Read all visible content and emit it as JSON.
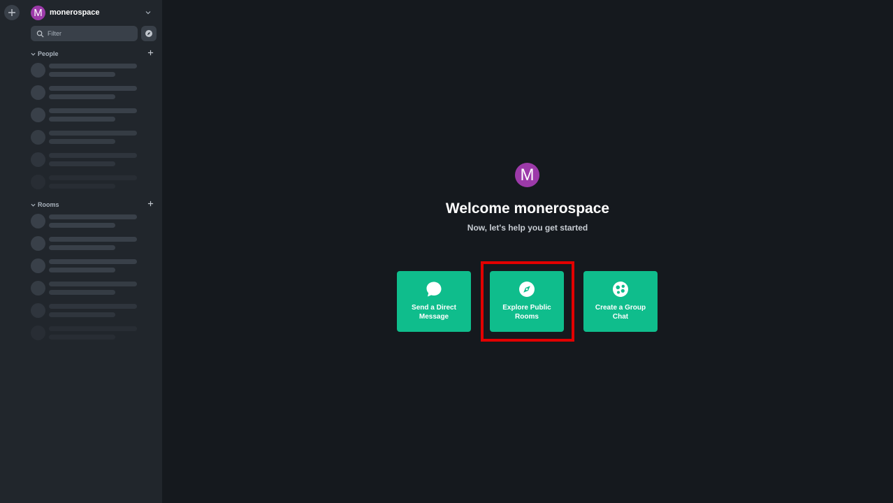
{
  "space_bar": {
    "create_space_icon": "plus-icon"
  },
  "sidebar": {
    "user": {
      "avatar_letter": "M",
      "name": "monerospace"
    },
    "filter": {
      "placeholder": "Filter"
    },
    "sections": [
      {
        "label": "People"
      },
      {
        "label": "Rooms"
      }
    ]
  },
  "welcome": {
    "avatar_letter": "M",
    "title": "Welcome monerospace",
    "subtitle": "Now, let's help you get started",
    "actions": [
      {
        "label": "Send a Direct Message",
        "icon": "chat-bubble-icon"
      },
      {
        "label": "Explore Public Rooms",
        "icon": "compass-icon"
      },
      {
        "label": "Create a Group Chat",
        "icon": "group-icon"
      }
    ]
  },
  "colors": {
    "accent": "#0fbd8c",
    "avatar": "#9c3aa9",
    "background": "#15191e",
    "sidebar": "#21262c",
    "highlight": "#e20000"
  }
}
